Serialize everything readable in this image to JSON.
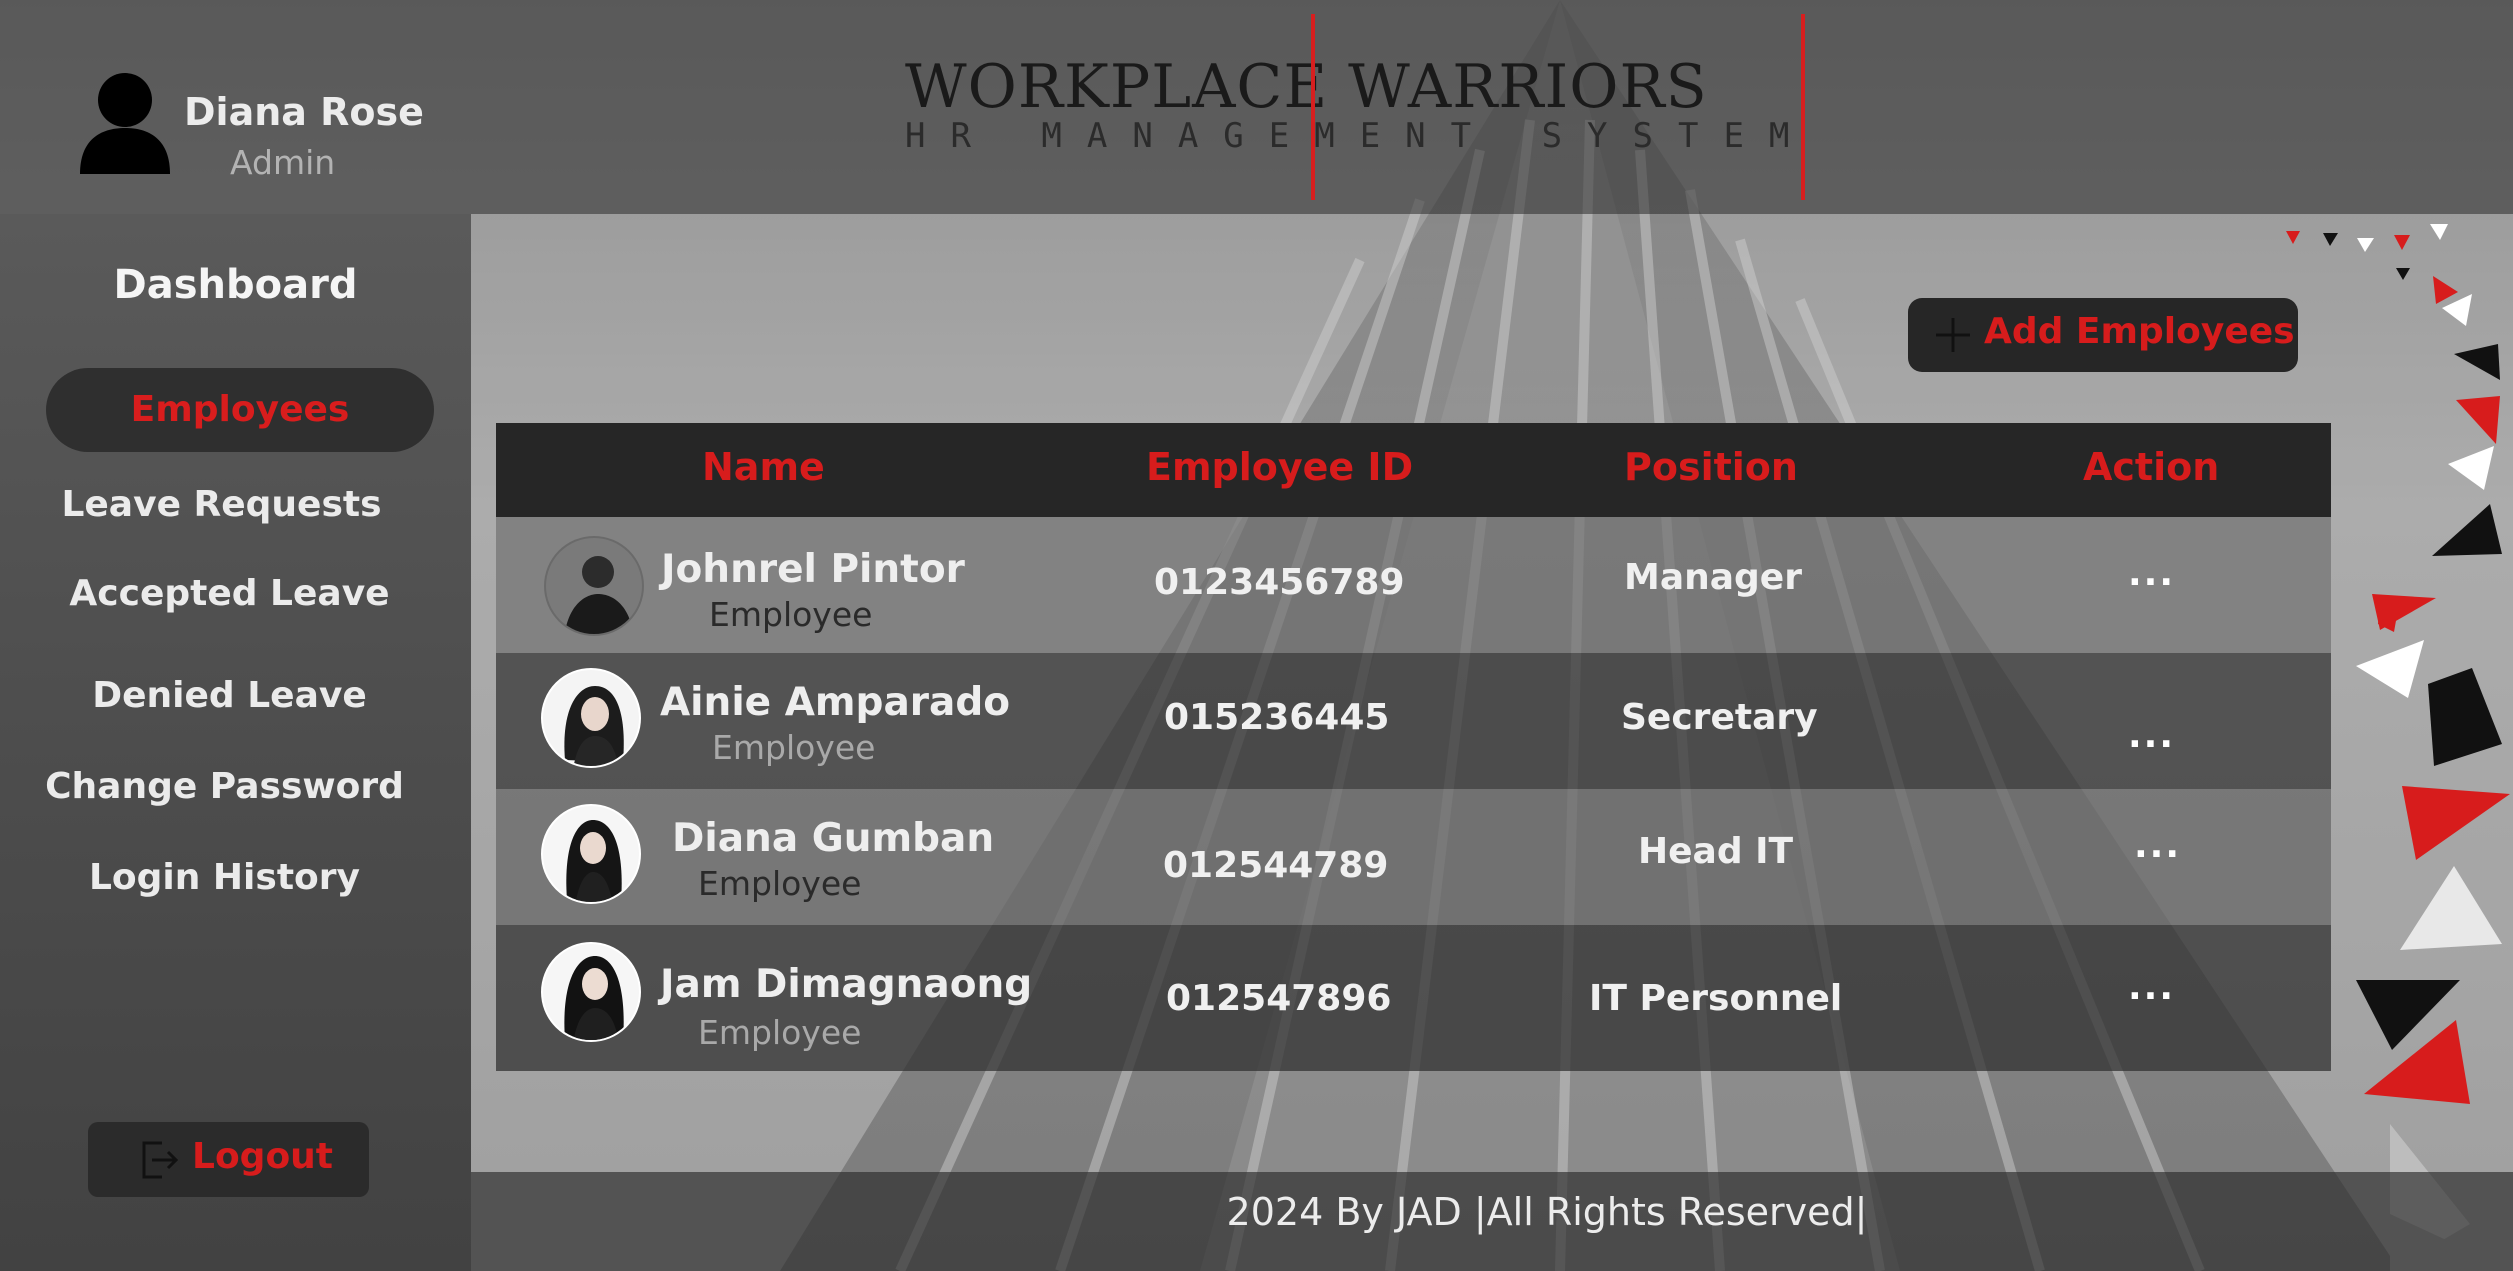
{
  "user": {
    "name": "Diana Rose",
    "role": "Admin"
  },
  "brand": {
    "title": "WORKPLACE WARRIORS",
    "subtitle": "HR MANAGEMENT SYSTEM"
  },
  "sidebar": {
    "items": [
      {
        "label": "Dashboard"
      },
      {
        "label": "Employees",
        "active": true
      },
      {
        "label": "Leave Requests"
      },
      {
        "label": "Accepted Leave"
      },
      {
        "label": "Denied Leave"
      },
      {
        "label": "Change Password"
      },
      {
        "label": "Login History"
      }
    ],
    "logout_label": "Logout"
  },
  "toolbar": {
    "add_label": "Add Employees"
  },
  "table": {
    "headers": [
      "Name",
      "Employee ID",
      "Position",
      "Action"
    ],
    "rows": [
      {
        "name": "Johnrel Pintor",
        "role": "Employee",
        "id": "0123456789",
        "position": "Manager",
        "action": "..."
      },
      {
        "name": "Ainie Amparado",
        "role": "Employee",
        "id": "015236445",
        "position": "Secretary",
        "action": "..."
      },
      {
        "name": "Diana Gumban",
        "role": "Employee",
        "id": "012544789",
        "position": "Head IT",
        "action": "..."
      },
      {
        "name": "Jam Dimagnaong",
        "role": "Employee",
        "id": "012547896",
        "position": "IT Personnel",
        "action": "..."
      }
    ]
  },
  "footer": {
    "text": "2024 By JAD |All Rights Reserved|"
  },
  "colors": {
    "accent": "#d71c1c",
    "dark": "#262626"
  },
  "icons": {
    "avatar": "user-silhouette-icon",
    "logout": "logout-icon",
    "add": "plus-icon",
    "action": "more-dots-icon"
  }
}
